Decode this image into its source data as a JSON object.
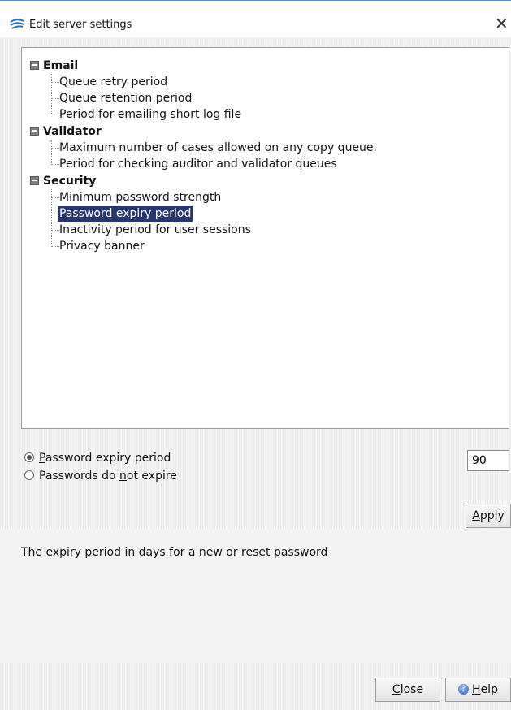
{
  "window": {
    "title": "Edit server settings",
    "close_glyph": "✕"
  },
  "tree": {
    "categories": [
      {
        "label": "Email",
        "items": [
          "Queue retry period",
          "Queue retention period",
          "Period for emailing short log file"
        ]
      },
      {
        "label": "Validator",
        "items": [
          "Maximum number of cases allowed on any copy queue.",
          "Period for checking auditor and validator queues"
        ]
      },
      {
        "label": "Security",
        "items": [
          "Minimum password strength",
          "Password expiry period",
          "Inactivity period for user sessions",
          "Privacy banner"
        ]
      }
    ],
    "selected_item": "Password expiry period"
  },
  "options": {
    "radio1": {
      "prefix": "",
      "mnemonic": "P",
      "rest": "assword expiry period",
      "checked": true
    },
    "radio2": {
      "prefix": "Passwords do ",
      "mnemonic": "n",
      "rest": "ot expire",
      "checked": false
    },
    "value": "90"
  },
  "buttons": {
    "apply": {
      "mnemonic": "A",
      "rest": "pply"
    },
    "close": {
      "mnemonic": "C",
      "rest": "lose"
    },
    "help": {
      "mnemonic": "H",
      "rest": "elp"
    }
  },
  "description": "The expiry period in days for a new or reset password",
  "icons": {
    "app": "feather-app-icon",
    "help": "help-icon",
    "close": "close-icon"
  }
}
